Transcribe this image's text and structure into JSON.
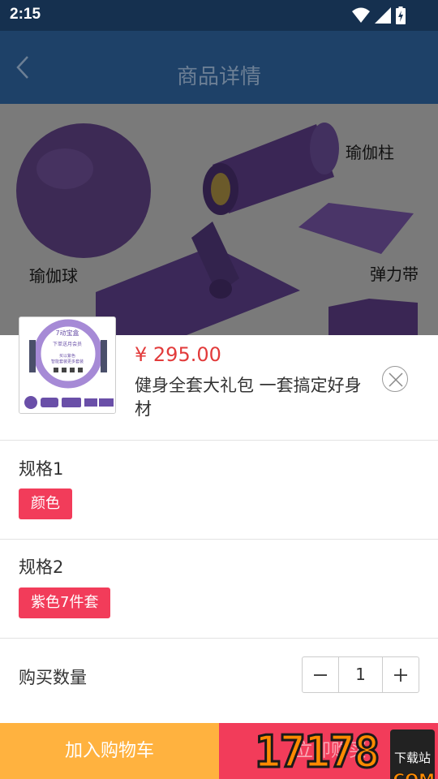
{
  "status_bar": {
    "time": "2:15"
  },
  "header": {
    "title": "商品详情"
  },
  "hero": {
    "labels": {
      "ball": "瑜伽球",
      "roller": "瑜伽柱",
      "band": "弹力带"
    }
  },
  "thumb": {
    "line1": "7动宝盒",
    "line2": "下单送月会员",
    "line3": "买以紫色",
    "line4": "智能套装更多套装"
  },
  "product": {
    "price": "¥ 295.00",
    "title": "健身全套大礼包 一套搞定好身材"
  },
  "specs": [
    {
      "label": "规格1",
      "selected": "颜色"
    },
    {
      "label": "规格2",
      "selected": "紫色7件套"
    }
  ],
  "quantity": {
    "label": "购买数量",
    "value": "1"
  },
  "footer": {
    "add_to_cart": "加入购物车",
    "buy_now": "立即购买"
  },
  "watermark": {
    "number": "17178",
    "badge": "下载站",
    "domain": ".COM"
  },
  "colors": {
    "header": "#1e4168",
    "price": "#e23b3b",
    "tag": "#f23c5a",
    "cart": "#ffb23f",
    "buy": "#f23c5a"
  }
}
